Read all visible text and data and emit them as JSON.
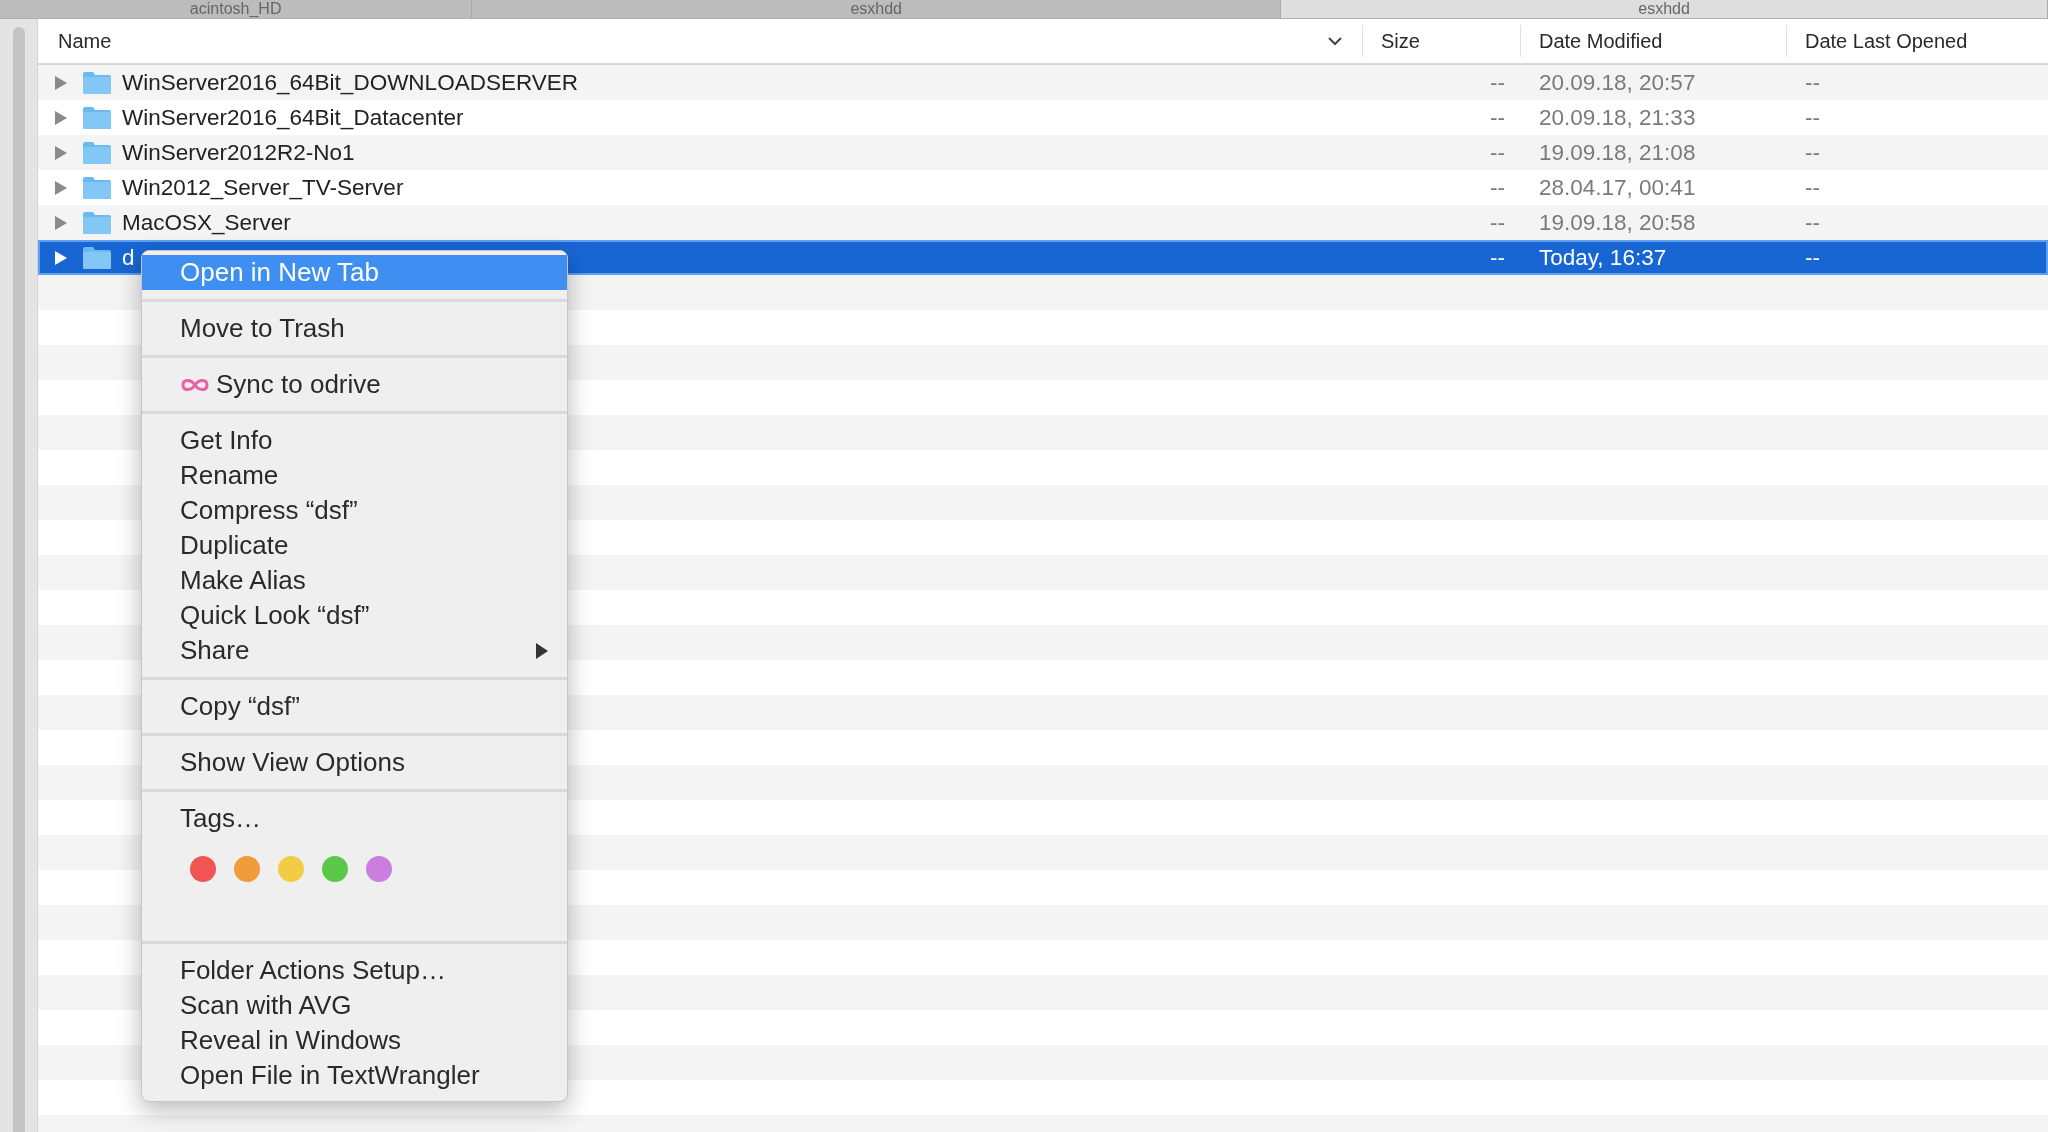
{
  "tabs": [
    {
      "label": "acintosh_HD",
      "selected": false
    },
    {
      "label": "esxhdd",
      "selected": false
    },
    {
      "label": "esxhdd",
      "selected": true
    }
  ],
  "table": {
    "columns": [
      "Name",
      "Size",
      "Date Modified",
      "Date Last Opened"
    ],
    "rows": [
      {
        "name": "WinServer2016_64Bit_DOWNLOADSERVER",
        "size": "--",
        "date_modified": "20.09.18, 20:57",
        "date_last_opened": "--",
        "selected": false
      },
      {
        "name": "WinServer2016_64Bit_Datacenter",
        "size": "--",
        "date_modified": "20.09.18, 21:33",
        "date_last_opened": "--",
        "selected": false
      },
      {
        "name": "WinServer2012R2-No1",
        "size": "--",
        "date_modified": "19.09.18, 21:08",
        "date_last_opened": "--",
        "selected": false
      },
      {
        "name": "Win2012_Server_TV-Server",
        "size": "--",
        "date_modified": "28.04.17, 00:41",
        "date_last_opened": "--",
        "selected": false
      },
      {
        "name": "MacOSX_Server",
        "size": "--",
        "date_modified": "19.09.18, 20:58",
        "date_last_opened": "--",
        "selected": false
      },
      {
        "name": "d",
        "size": "--",
        "date_modified": "Today, 16:37",
        "date_last_opened": "--",
        "selected": true
      }
    ]
  },
  "context_menu": {
    "sections": [
      {
        "items": [
          {
            "label": "Open in New Tab",
            "kind": "plain",
            "selected": true,
            "submenu": false
          }
        ]
      },
      {
        "items": [
          {
            "label": "Move to Trash",
            "kind": "plain",
            "selected": false,
            "submenu": false
          }
        ]
      },
      {
        "items": [
          {
            "label": "Sync to odrive",
            "kind": "with_icon",
            "selected": false,
            "submenu": false
          }
        ]
      },
      {
        "items": [
          {
            "label": "Get Info",
            "kind": "plain",
            "selected": false,
            "submenu": false
          },
          {
            "label": "Rename",
            "kind": "plain",
            "selected": false,
            "submenu": false
          },
          {
            "label": "Compress “dsf”",
            "kind": "plain",
            "selected": false,
            "submenu": false
          },
          {
            "label": "Duplicate",
            "kind": "plain",
            "selected": false,
            "submenu": false
          },
          {
            "label": "Make Alias",
            "kind": "plain",
            "selected": false,
            "submenu": false
          },
          {
            "label": "Quick Look “dsf”",
            "kind": "plain",
            "selected": false,
            "submenu": false
          },
          {
            "label": "Share",
            "kind": "plain",
            "selected": false,
            "submenu": true
          }
        ]
      },
      {
        "items": [
          {
            "label": "Copy “dsf”",
            "kind": "plain",
            "selected": false,
            "submenu": false
          }
        ]
      },
      {
        "items": [
          {
            "label": "Show View Options",
            "kind": "plain",
            "selected": false,
            "submenu": false
          }
        ]
      },
      {
        "items": [
          {
            "label": "Tags…",
            "kind": "plain",
            "selected": false,
            "submenu": false
          }
        ],
        "tag_colors": [
          {
            "color": "#f25353"
          },
          {
            "color": "#f29b3d"
          },
          {
            "color": "#f2cd44"
          },
          {
            "color": "#5cc84a"
          },
          {
            "color": "#c97ee0"
          }
        ]
      },
      {
        "items": [
          {
            "label": "Folder Actions Setup…",
            "kind": "plain",
            "selected": false,
            "submenu": false
          },
          {
            "label": "Scan with AVG",
            "kind": "plain",
            "selected": false,
            "submenu": false
          },
          {
            "label": "Reveal in Windows",
            "kind": "plain",
            "selected": false,
            "submenu": false
          },
          {
            "label": "Open File in TextWrangler",
            "kind": "plain",
            "selected": false,
            "submenu": false
          }
        ]
      }
    ]
  }
}
